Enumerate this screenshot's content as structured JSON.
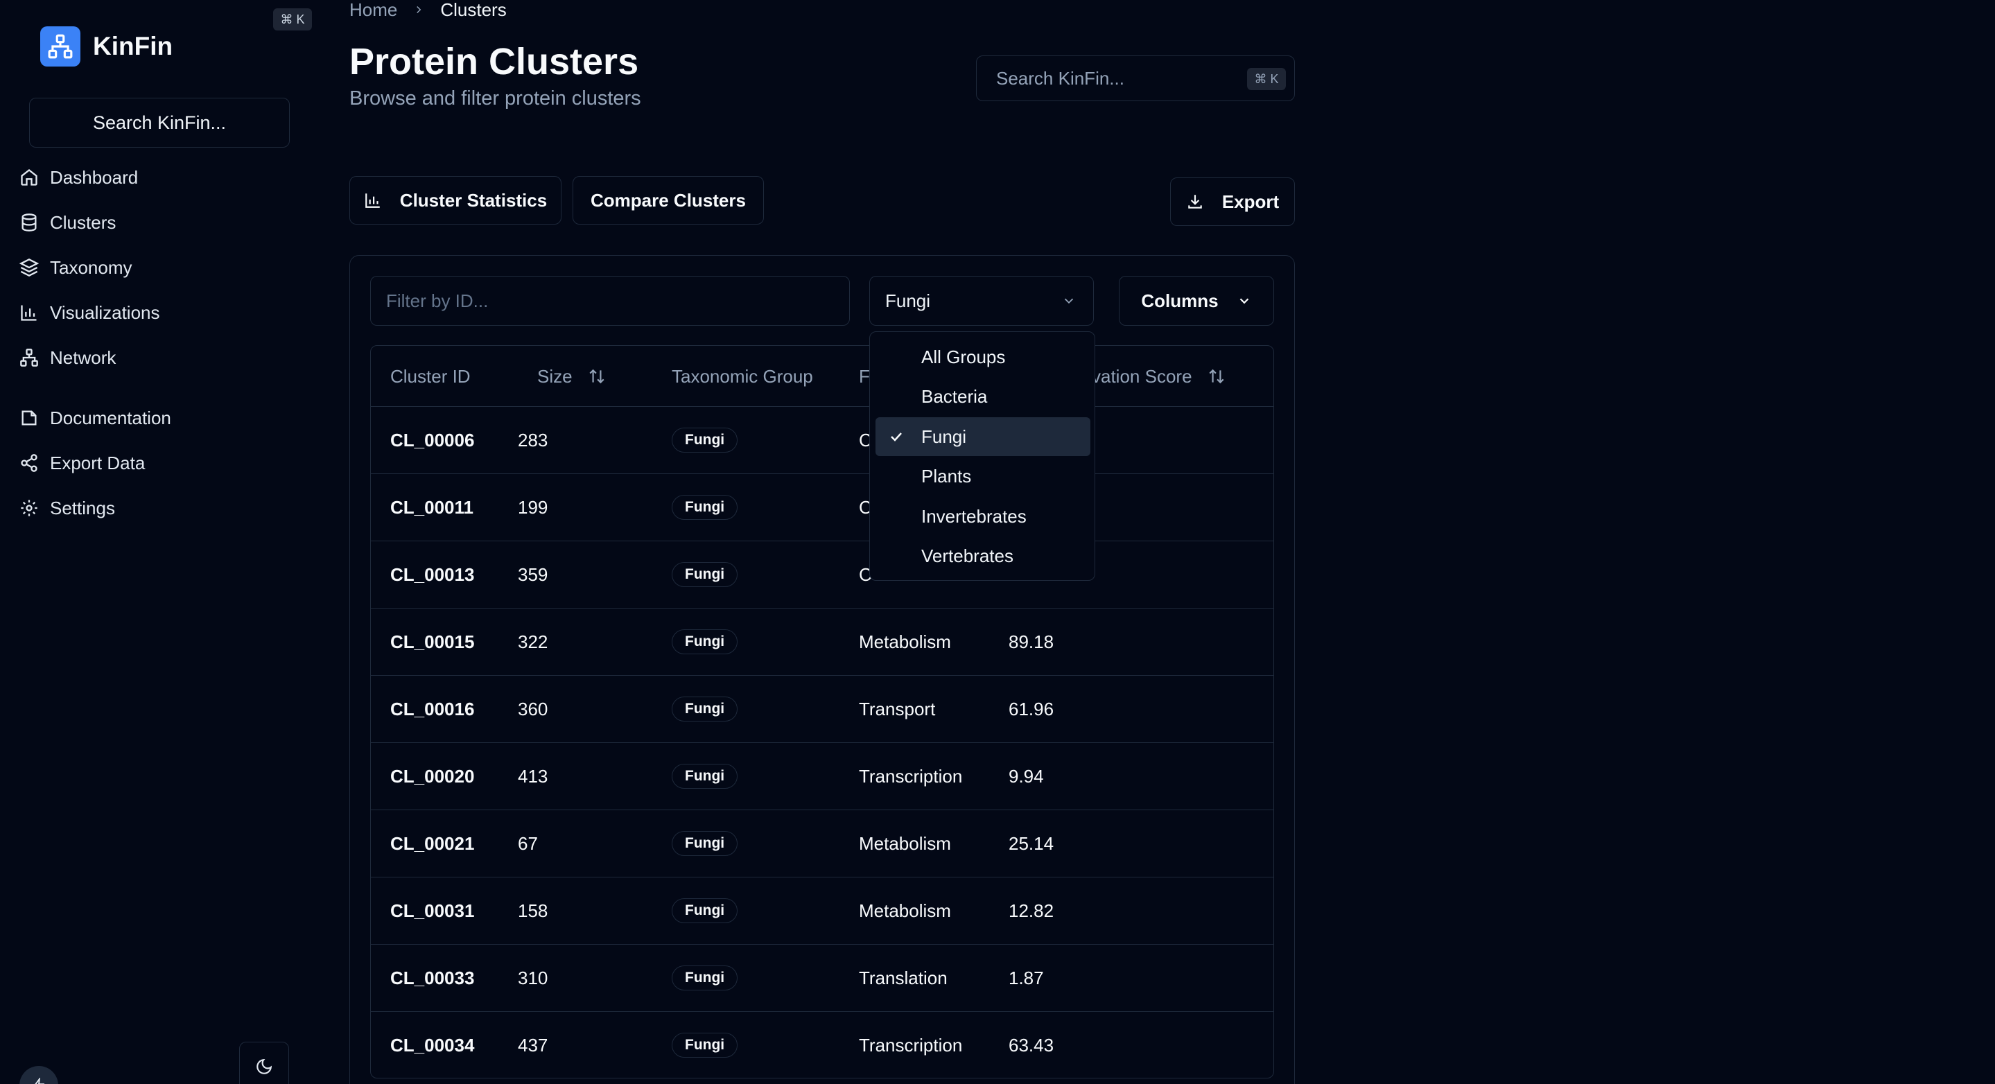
{
  "app": {
    "name": "KinFin",
    "shortcut": "⌘ K"
  },
  "sidebar": {
    "search_label": "Search KinFin...",
    "nav": [
      {
        "label": "Dashboard",
        "icon": "home-icon"
      },
      {
        "label": "Clusters",
        "icon": "database-icon"
      },
      {
        "label": "Taxonomy",
        "icon": "layers-icon"
      },
      {
        "label": "Visualizations",
        "icon": "bar-chart-icon"
      },
      {
        "label": "Network",
        "icon": "network-icon"
      }
    ],
    "secondary": [
      {
        "label": "Documentation",
        "icon": "book-icon"
      },
      {
        "label": "Export Data",
        "icon": "share-icon"
      },
      {
        "label": "Settings",
        "icon": "gear-icon"
      }
    ]
  },
  "breadcrumb": {
    "home": "Home",
    "current": "Clusters"
  },
  "header": {
    "title": "Protein Clusters",
    "subtitle": "Browse and filter protein clusters",
    "search_placeholder": "Search KinFin...",
    "search_shortcut": "⌘ K"
  },
  "toolbar": {
    "cluster_stats": "Cluster Statistics",
    "compare": "Compare Clusters",
    "export": "Export"
  },
  "filters": {
    "id_placeholder": "Filter by ID...",
    "group_selected": "Fungi",
    "columns_label": "Columns",
    "group_options": [
      "All Groups",
      "Bacteria",
      "Fungi",
      "Plants",
      "Invertebrates",
      "Vertebrates"
    ]
  },
  "table": {
    "headers": {
      "cluster_id": "Cluster ID",
      "size": "Size",
      "taxonomic_group": "Taxonomic Group",
      "function_partial": "F",
      "conservation_partial": "vation Score"
    },
    "rows": [
      {
        "id": "CL_00006",
        "size": "283",
        "group": "Fungi",
        "function": "C",
        "score": ""
      },
      {
        "id": "CL_00011",
        "size": "199",
        "group": "Fungi",
        "function": "C",
        "score": ""
      },
      {
        "id": "CL_00013",
        "size": "359",
        "group": "Fungi",
        "function": "C",
        "score": ""
      },
      {
        "id": "CL_00015",
        "size": "322",
        "group": "Fungi",
        "function": "Metabolism",
        "score": "89.18"
      },
      {
        "id": "CL_00016",
        "size": "360",
        "group": "Fungi",
        "function": "Transport",
        "score": "61.96"
      },
      {
        "id": "CL_00020",
        "size": "413",
        "group": "Fungi",
        "function": "Transcription",
        "score": "9.94"
      },
      {
        "id": "CL_00021",
        "size": "67",
        "group": "Fungi",
        "function": "Metabolism",
        "score": "25.14"
      },
      {
        "id": "CL_00031",
        "size": "158",
        "group": "Fungi",
        "function": "Metabolism",
        "score": "12.82"
      },
      {
        "id": "CL_00033",
        "size": "310",
        "group": "Fungi",
        "function": "Translation",
        "score": "1.87"
      },
      {
        "id": "CL_00034",
        "size": "437",
        "group": "Fungi",
        "function": "Transcription",
        "score": "63.43"
      }
    ]
  },
  "colors": {
    "background": "#030816",
    "border": "#1e293b",
    "accent": "#3b82f6",
    "muted_text": "#94a3b8"
  }
}
